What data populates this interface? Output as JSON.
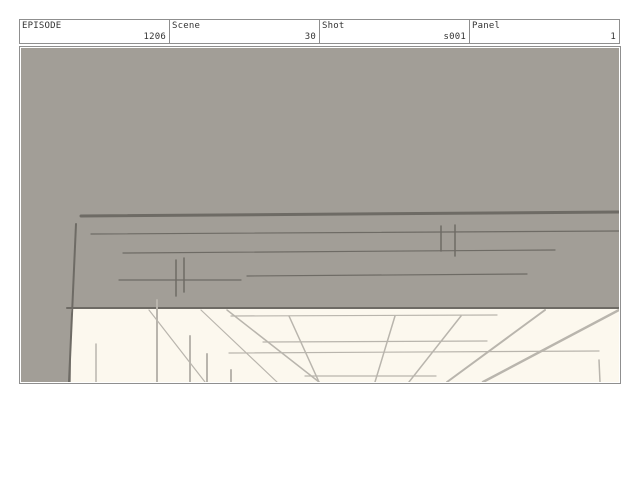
{
  "header": {
    "fields": [
      {
        "label": "EPISODE",
        "value": "1206"
      },
      {
        "label": "Scene",
        "value": "30"
      },
      {
        "label": "Shot",
        "value": "s001"
      },
      {
        "label": "Panel",
        "value": "1"
      }
    ]
  },
  "panel": {
    "colors": {
      "wall": "#a29e97",
      "ceiling": "#fcf8ee",
      "sketch_dark": "#6e6b65",
      "sketch_light": "#b9b5ad"
    }
  }
}
